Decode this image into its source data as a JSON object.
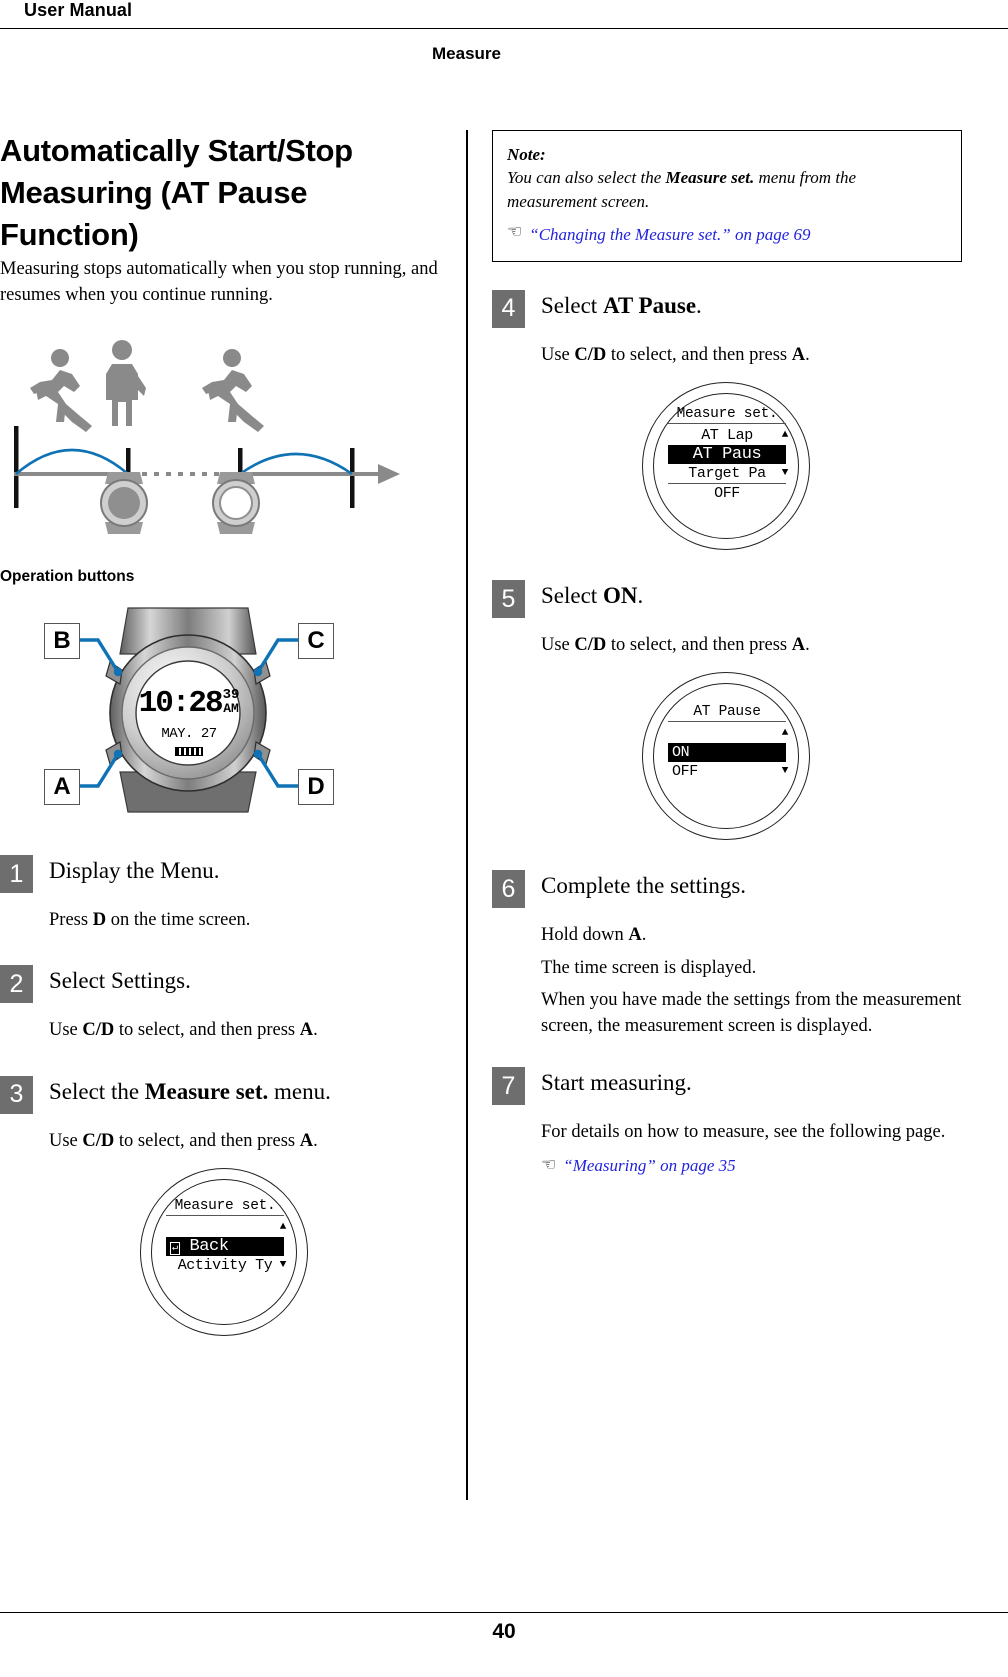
{
  "header": {
    "manual_label": "User Manual",
    "chapter": "Measure"
  },
  "footer": {
    "page_number": "40"
  },
  "left": {
    "title": "Automatically Start/Stop Measuring (AT Pause Function)",
    "intro": "Measuring stops automatically when you stop running, and resumes when you continue running.",
    "operation_buttons_heading": "Operation buttons",
    "watch_callouts": {
      "b": "B",
      "c": "C",
      "a": "A",
      "d": "D"
    },
    "watch_face": {
      "time": "10:28",
      "seconds": "39",
      "ampm": "AM",
      "date": "MAY. 27"
    },
    "steps": [
      {
        "num": "1",
        "title": "Display the Menu.",
        "lines": [
          "Press D on the time screen."
        ]
      },
      {
        "num": "2",
        "title": "Select Settings.",
        "lines": [
          "Use C/D to select, and then press A."
        ]
      },
      {
        "num": "3",
        "title": "Select the Measure set. menu.",
        "lines": [
          "Use C/D to select, and then press A."
        ],
        "lcd": {
          "title": "Measure set.",
          "rows": [
            {
              "text": "Back",
              "selected": true,
              "icon": "back-arrow"
            },
            {
              "text": "Activity Ty",
              "selected": false
            }
          ],
          "scroll_up": true,
          "scroll_down": true
        }
      }
    ]
  },
  "right": {
    "note": {
      "label": "Note:",
      "text_before": "You can also select the ",
      "bold_term": "Measure set.",
      "text_after": " menu from the measurement screen.",
      "xref": "“Changing the Measure set.” on page 69"
    },
    "steps": [
      {
        "num": "4",
        "title_before": "Select ",
        "title_bold": "AT Pause",
        "title_after": ".",
        "lines": [
          "Use C/D to select, and then press A."
        ],
        "lcd": {
          "title": "Measure set.",
          "rows": [
            {
              "text": "AT Lap",
              "selected": false
            },
            {
              "text": "AT Paus",
              "selected": true
            },
            {
              "text": "Target Pa",
              "selected": false
            },
            {
              "text": "OFF",
              "selected": false
            }
          ],
          "scroll_up": true,
          "scroll_down": true
        }
      },
      {
        "num": "5",
        "title_before": "Select ",
        "title_bold": "ON",
        "title_after": ".",
        "lines": [
          "Use C/D to select, and then press A."
        ],
        "lcd": {
          "title": "AT Pause",
          "rows": [
            {
              "text": "ON",
              "selected": true
            },
            {
              "text": "OFF",
              "selected": false
            }
          ],
          "scroll_up": true,
          "scroll_down": true
        }
      },
      {
        "num": "6",
        "title_before": "Complete the settings.",
        "title_bold": "",
        "title_after": "",
        "lines": [
          "Hold down A.",
          "The time screen is displayed.",
          "When you have made the settings from the measurement screen, the measurement screen is displayed."
        ]
      },
      {
        "num": "7",
        "title_before": "Start measuring.",
        "title_bold": "",
        "title_after": "",
        "lines": [
          "For details on how to measure, see the following page."
        ],
        "xref": "“Measuring” on page 35"
      }
    ]
  },
  "colors": {
    "accent_blue": "#0f72b5",
    "link_blue": "#2222dd",
    "step_gray": "#6e6e6e",
    "figure_gray": "#8a8a8a"
  }
}
